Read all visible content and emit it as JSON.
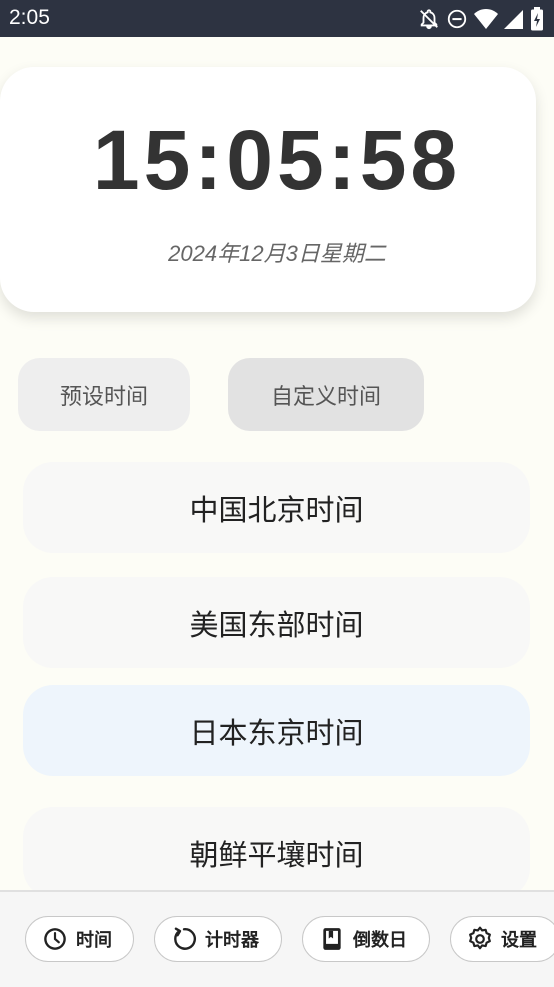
{
  "status_bar": {
    "time": "2:05",
    "icons": [
      "notifications-off-icon",
      "do-not-disturb-icon",
      "wifi-icon",
      "signal-icon",
      "battery-charging-icon"
    ]
  },
  "clock": {
    "time": "15:05:58",
    "date": "2024年12月3日星期二"
  },
  "mode_tabs": {
    "preset": "预设时间",
    "custom": "自定义时间"
  },
  "timezones": [
    {
      "label": "中国北京时间",
      "selected": false
    },
    {
      "label": "美国东部时间",
      "selected": false
    },
    {
      "label": "日本东京时间",
      "selected": true
    },
    {
      "label": "朝鲜平壤时间",
      "selected": false
    }
  ],
  "bottom_nav": [
    {
      "label": "时间",
      "icon": "clock-icon"
    },
    {
      "label": "计时器",
      "icon": "refresh-icon"
    },
    {
      "label": "倒数日",
      "icon": "book-icon"
    },
    {
      "label": "设置",
      "icon": "gear-icon"
    }
  ],
  "colors": {
    "background": "#fdfdf6",
    "status_bar": "#2d3341",
    "selected_item": "#eef5fc"
  }
}
